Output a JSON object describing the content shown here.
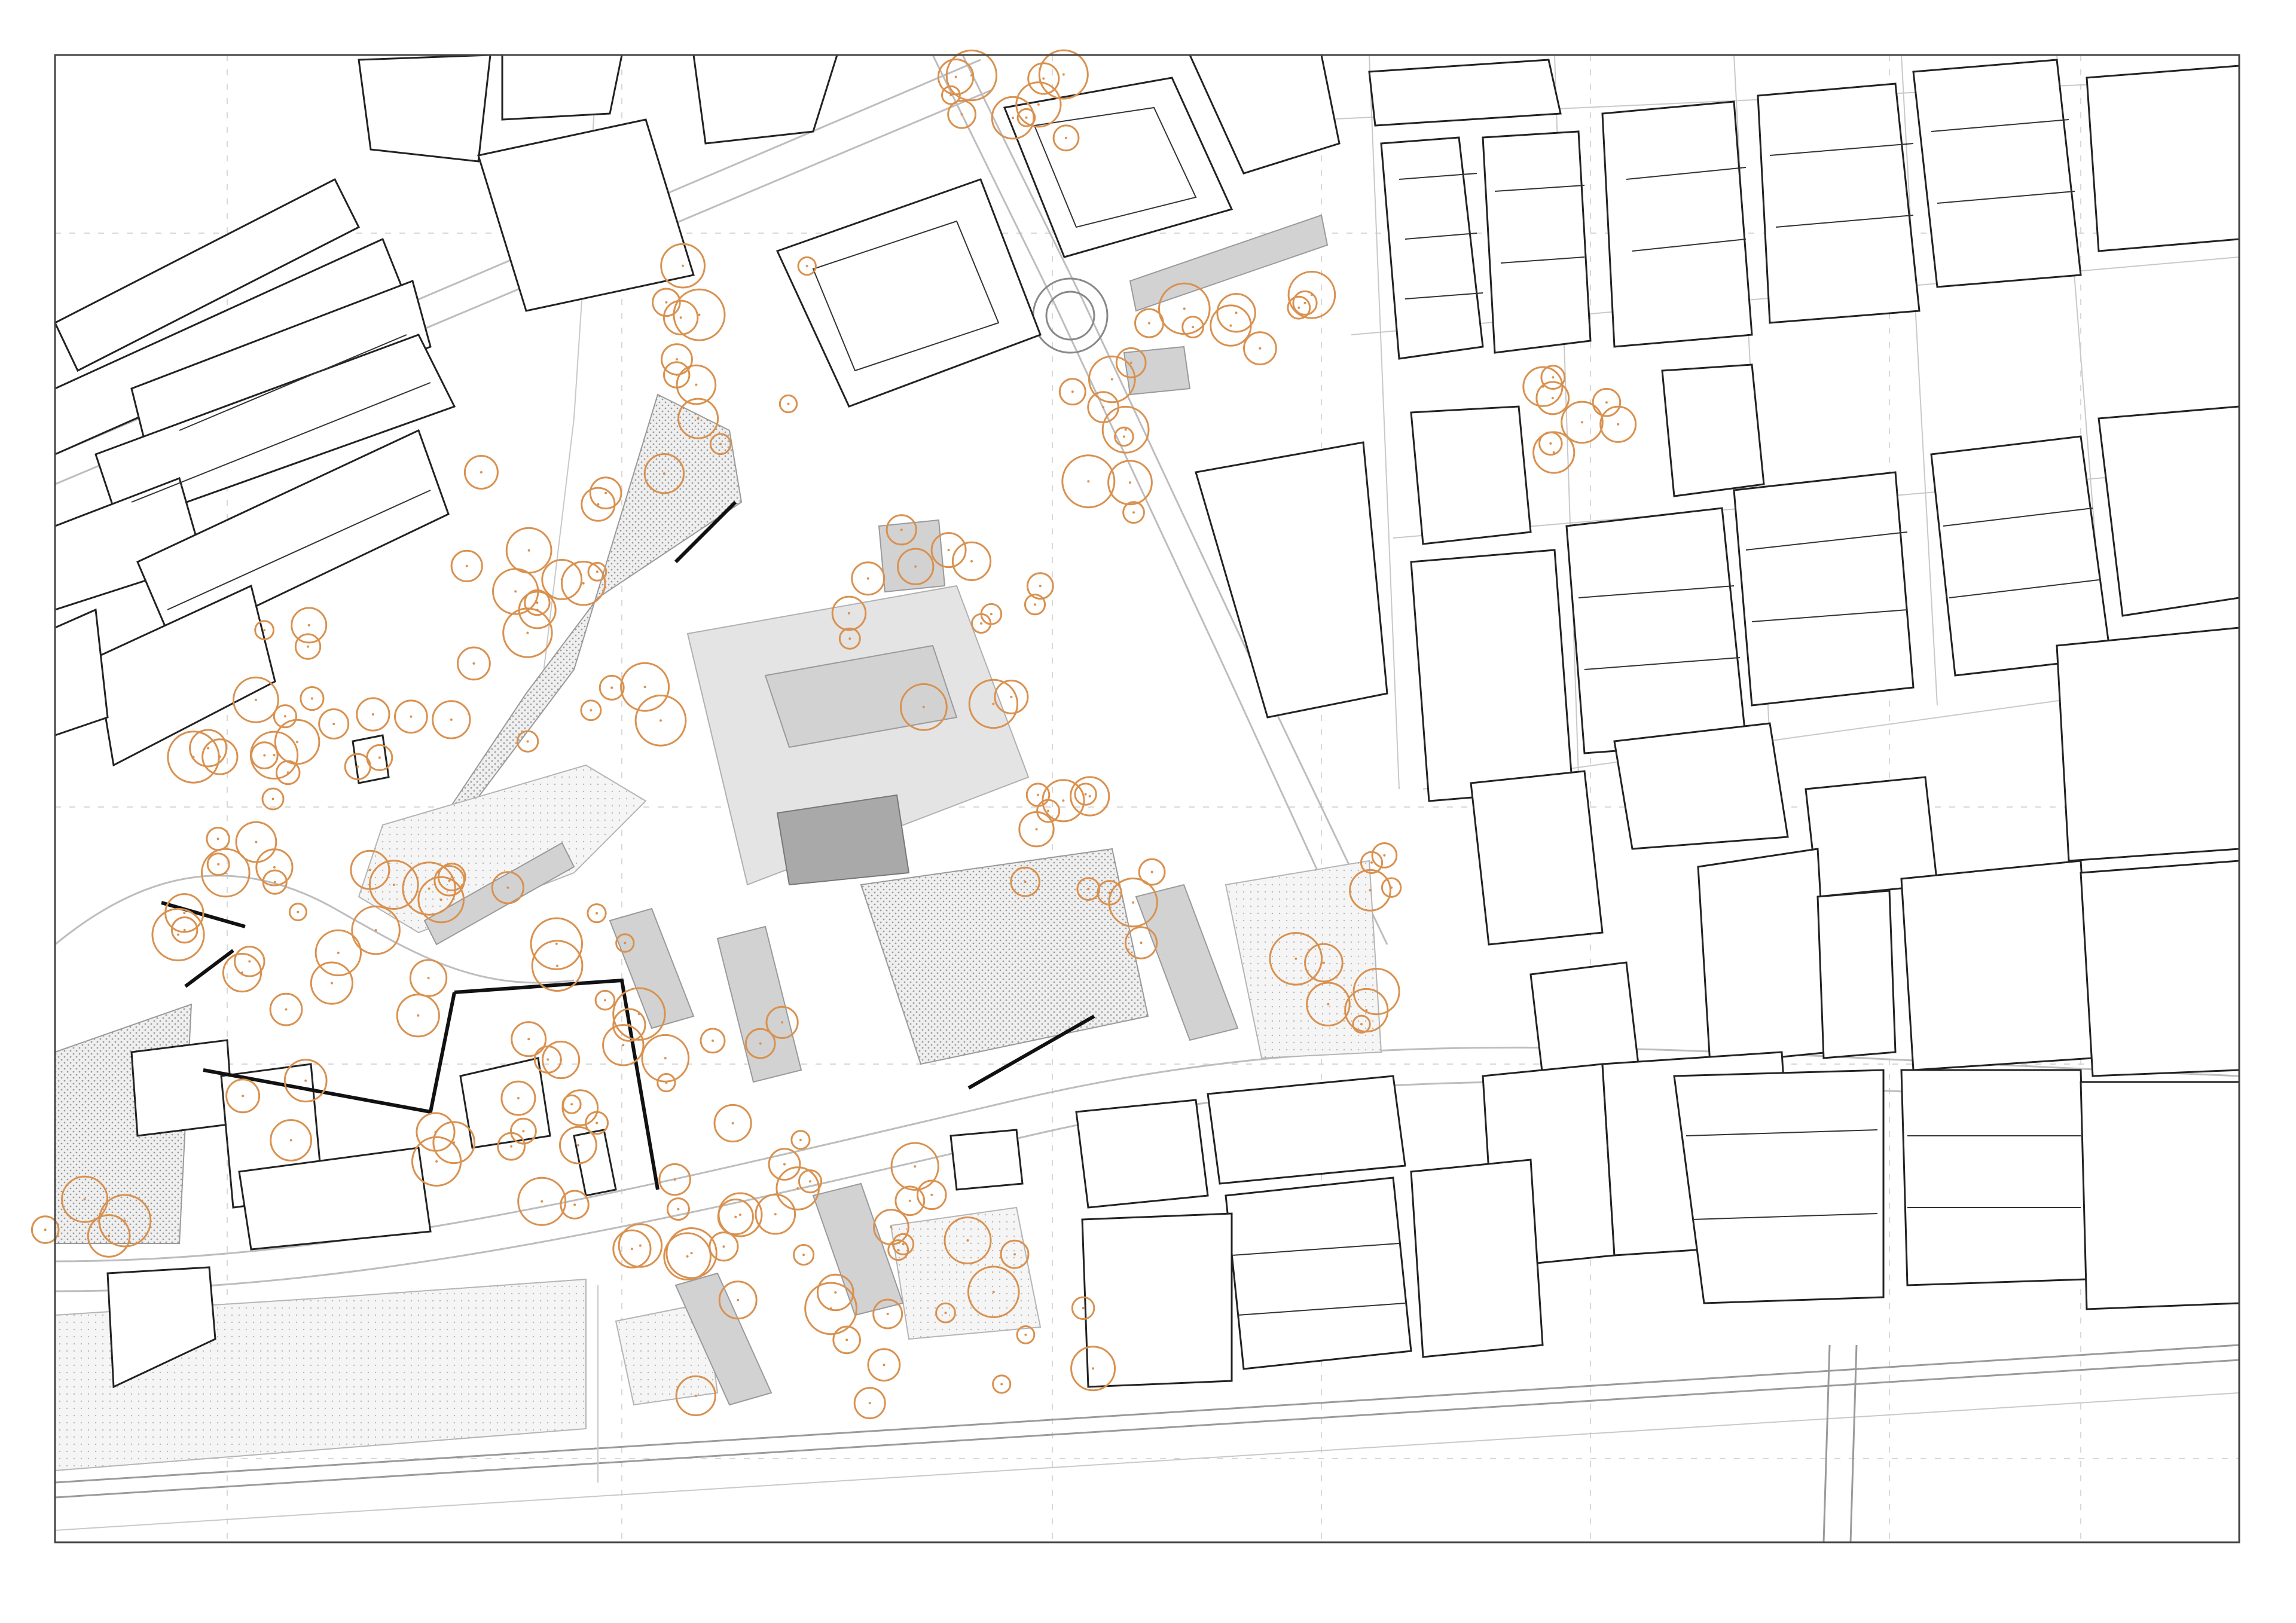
{
  "map": {
    "type": "urban site plan",
    "legend": [],
    "colors": {
      "background": "#ffffff",
      "building_outline": "#222222",
      "road_line": "#bdbdbd",
      "tree_canopy": "#d9914f",
      "paved_hatch": "#9a9a9a",
      "project_building": "#d2d2d2"
    },
    "features": [
      "building-blocks",
      "street-network",
      "roundabout",
      "tree-canopies",
      "paved-plazas",
      "project-buildings",
      "railway-corridor",
      "drawing-frame",
      "grid-lines"
    ]
  }
}
